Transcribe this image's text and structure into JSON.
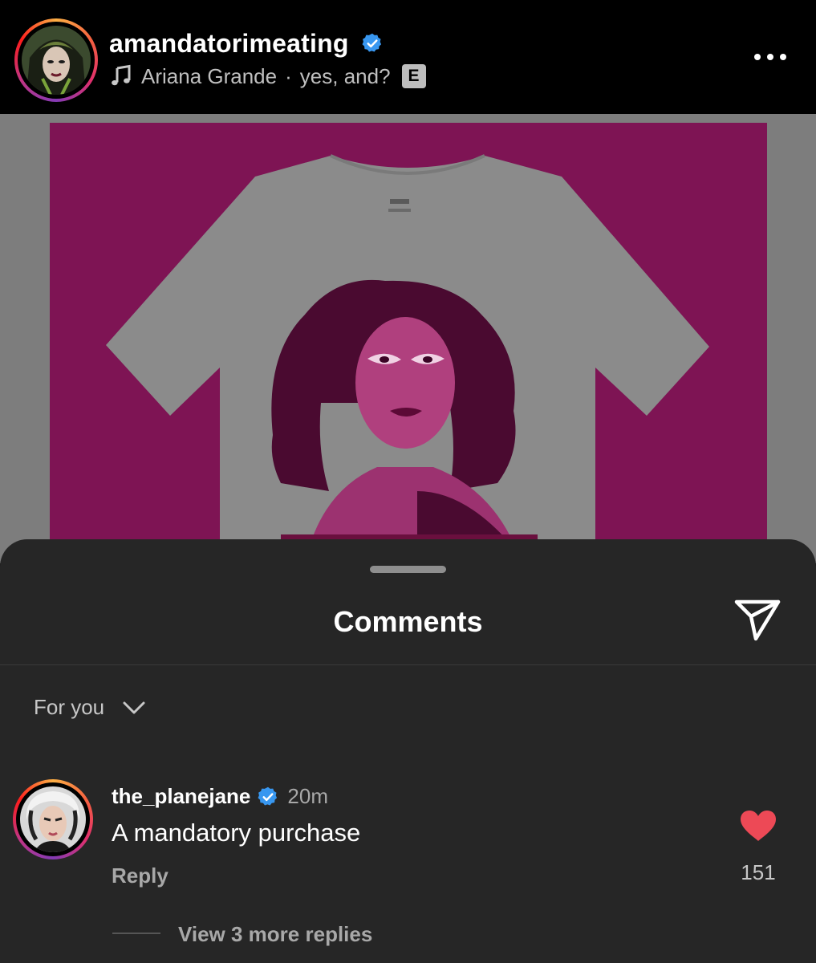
{
  "post": {
    "username": "amandatorimeating",
    "verified": true,
    "music_artist": "Ariana Grande",
    "music_separator": "·",
    "music_track": "yes, and?",
    "explicit_badge": "E",
    "more_icon": "more-horizontal-icon"
  },
  "sheet": {
    "title": "Comments",
    "share_icon": "paper-plane-icon",
    "filter_label": "For you",
    "filter_icon": "chevron-down-icon"
  },
  "comments": [
    {
      "username": "the_planejane",
      "verified": true,
      "time": "20m",
      "text": "A mandatory purchase",
      "reply_label": "Reply",
      "likes": "151",
      "liked": true,
      "view_replies_label": "View 3 more replies"
    }
  ],
  "colors": {
    "background": "#000000",
    "sheet": "#262626",
    "verified_blue": "#3897f0",
    "like_red": "#ed4956",
    "media_magenta": "#7e1454",
    "shirt_gray": "#8b8b8b"
  }
}
